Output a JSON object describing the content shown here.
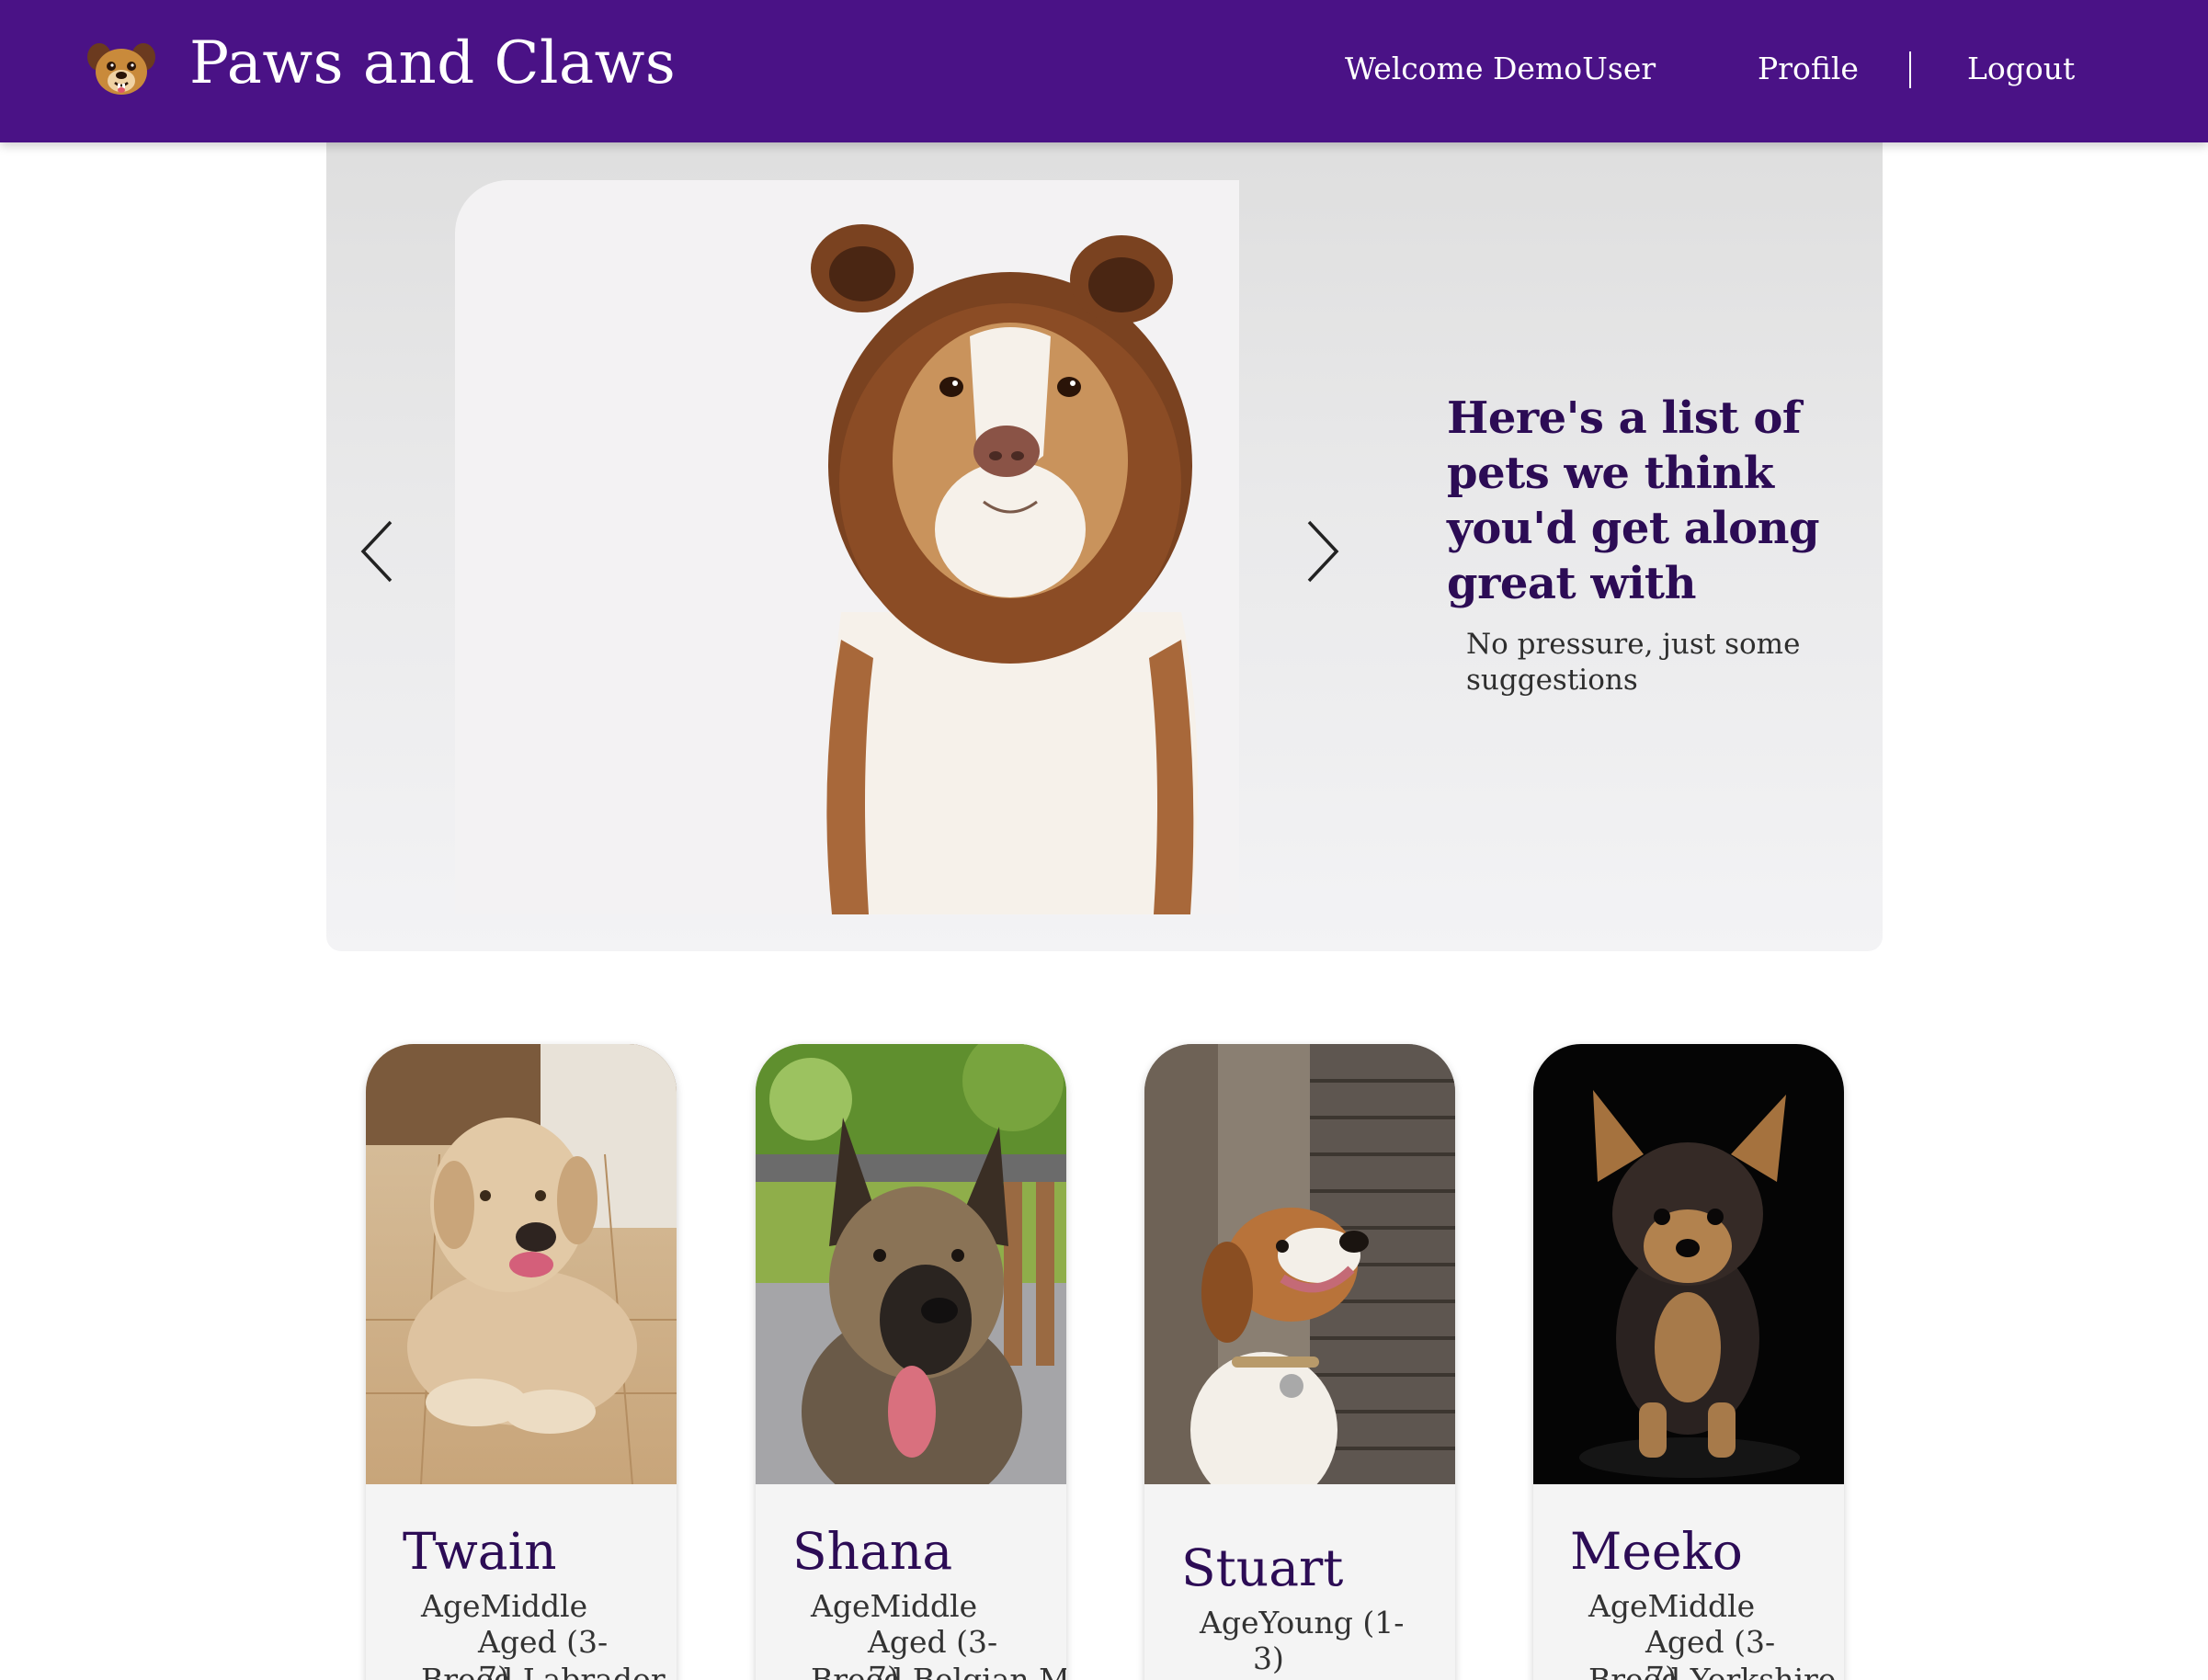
{
  "navbar": {
    "brand": "Paws and Claws",
    "welcome": "Welcome DemoUser",
    "profile": "Profile",
    "logout": "Logout"
  },
  "hero": {
    "heading": "Here's a list of pets we think you'd get along great with",
    "subheading": "No pressure, just some suggestions"
  },
  "pets": [
    {
      "name": "Twain",
      "age_prefix": "Age",
      "age_line1": "Middle",
      "age_line2": "Aged (3-7)",
      "breed": "Breed Labrador"
    },
    {
      "name": "Shana",
      "age_prefix": "Age",
      "age_line1": "Middle",
      "age_line2": "Aged (3-7)",
      "breed": "Breed Belgian Malinois"
    },
    {
      "name": "Stuart",
      "age_prefix": "Age",
      "age_line1": "Young (1-",
      "age_line2": "3)",
      "breed": ""
    },
    {
      "name": "Meeko",
      "age_prefix": "Age",
      "age_line1": "Middle",
      "age_line2": "Aged (3-7)",
      "breed": "Breed Yorkshire"
    }
  ],
  "colors": {
    "navbar": "#4a1286",
    "heading": "#2c0c55",
    "card_background": "#f4f4f4"
  }
}
